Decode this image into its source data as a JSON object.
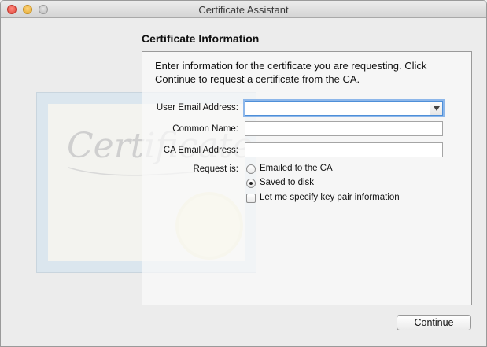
{
  "window": {
    "title": "Certificate Assistant"
  },
  "page": {
    "section_title": "Certificate Information",
    "instructions": "Enter information for the certificate you are requesting. Click Continue to request a certificate from the CA."
  },
  "form": {
    "user_email_label": "User Email Address:",
    "user_email_value": "",
    "common_name_label": "Common Name:",
    "common_name_value": "",
    "ca_email_label": "CA Email Address:",
    "ca_email_value": "",
    "request_label": "Request is:",
    "request_options": [
      {
        "label": "Emailed to the CA",
        "selected": false
      },
      {
        "label": "Saved to disk",
        "selected": true
      }
    ],
    "key_pair_label": "Let me specify key pair information",
    "key_pair_checked": false
  },
  "buttons": {
    "continue": "Continue"
  },
  "artwork": {
    "certificate_word": "Certificate"
  }
}
